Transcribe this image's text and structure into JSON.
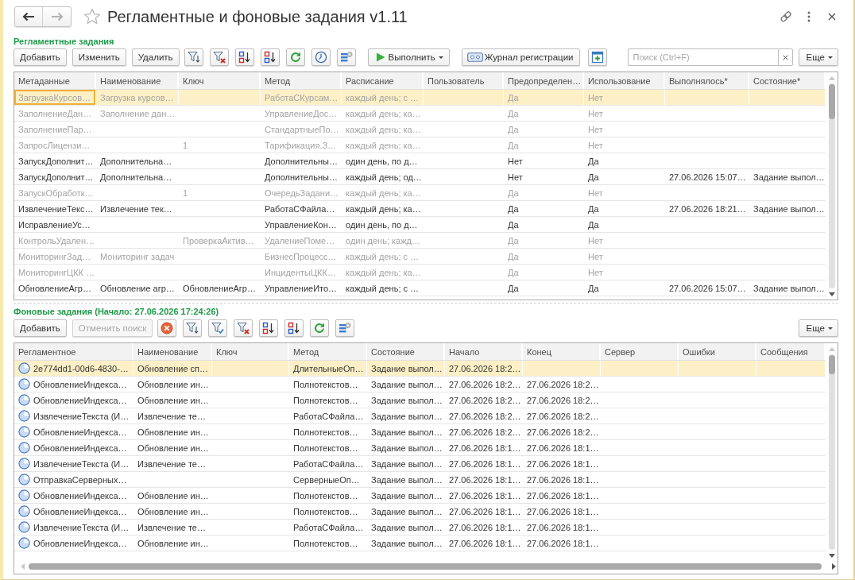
{
  "window": {
    "title": "Регламентные и фоновые задания v1.11",
    "favorite": false
  },
  "navigation": {
    "back": {
      "disabled": false
    },
    "forward": {
      "disabled": true
    }
  },
  "scheduled_jobs": {
    "title": "Регламентные задания",
    "toolbar": {
      "buttons": [
        {
          "label": "Добавить"
        },
        {
          "label": "Изменить"
        },
        {
          "label": "Удалить"
        }
      ],
      "run_button": {
        "label": "Выполнить"
      },
      "log_button": {
        "label": "Журнал регистрации"
      },
      "search": {
        "placeholder": "Поиск (Ctrl+F)"
      },
      "more_button": {
        "label": "Еще"
      }
    },
    "table": {
      "focused": true,
      "columns": [
        {
          "label": "Метаданные"
        },
        {
          "label": "Наименование"
        },
        {
          "label": "Ключ"
        },
        {
          "label": "Метод"
        },
        {
          "label": "Расписание"
        },
        {
          "label": "Пользователь"
        },
        {
          "label": "Предопределен…"
        },
        {
          "label": "Использование"
        },
        {
          "label": "Выполнялось*"
        },
        {
          "label": "Состояние*"
        }
      ],
      "rows": [
        {
          "selected": true,
          "inactive": true,
          "metadata": "ЗагрузкаКурсов…",
          "name": "Загрузка курсов…",
          "method": "РаботаСКурсам…",
          "schedule": "каждый день; с …",
          "predefined": "Да",
          "usage": "Нет"
        },
        {
          "selected": false,
          "inactive": true,
          "metadata": "ЗаполнениеДан…",
          "name": "Заполнение дан…",
          "method": "УправлениеДос…",
          "schedule": "каждый день; ка…",
          "predefined": "Да",
          "usage": "Нет"
        },
        {
          "selected": false,
          "inactive": true,
          "metadata": "ЗаполнениеПар…",
          "method": "СтандартныеПо…",
          "schedule": "каждый день; ка…",
          "predefined": "Да",
          "usage": "Нет"
        },
        {
          "selected": false,
          "inactive": true,
          "metadata": "ЗапросЛицензи…",
          "key": "1",
          "method": "Тарификация.З…",
          "schedule": "каждый день; ка…",
          "predefined": "Да",
          "usage": "Нет"
        },
        {
          "selected": false,
          "inactive": false,
          "metadata": "ЗапускДополнит…",
          "name": "Дополнительна…",
          "method": "Дополнительны…",
          "schedule": "один день, по д…",
          "predefined": "Нет",
          "usage": "Да"
        },
        {
          "selected": false,
          "inactive": false,
          "metadata": "ЗапускДополнит…",
          "name": "Дополнительна…",
          "method": "Дополнительны…",
          "schedule": "каждый день; од…",
          "predefined": "Нет",
          "usage": "Да",
          "last_run": "27.06.2026 15:07…",
          "state": "Задание выпол…"
        },
        {
          "selected": false,
          "inactive": true,
          "metadata": "ЗапускОбработк…",
          "key": "1",
          "method": "ОчередьЗадани…",
          "schedule": "каждый день; ка…",
          "predefined": "Да",
          "usage": "Нет"
        },
        {
          "selected": false,
          "inactive": false,
          "metadata": "ИзвлечениеТекс…",
          "name": "Извлечение тек…",
          "method": "РаботаСФайла…",
          "schedule": "каждый день; ка…",
          "predefined": "Да",
          "usage": "Да",
          "last_run": "27.06.2026 18:21…",
          "state": "Задание выпол…"
        },
        {
          "selected": false,
          "inactive": false,
          "metadata": "ИсправлениеУс…",
          "method": "УправлениеКон…",
          "schedule": "один день, по д…",
          "predefined": "Да",
          "usage": "Да"
        },
        {
          "selected": false,
          "inactive": true,
          "metadata": "КонтрольУдален…",
          "key": "ПроверкаАктив…",
          "method": "УдалениеПоме…",
          "schedule": "один день; кажд…",
          "predefined": "Да",
          "usage": "Нет"
        },
        {
          "selected": false,
          "inactive": true,
          "metadata": "МониторингЗад…",
          "name": "Мониторинг задач",
          "method": "БизнесПроцесс…",
          "schedule": "каждый день; с …",
          "predefined": "Да",
          "usage": "Нет"
        },
        {
          "selected": false,
          "inactive": true,
          "metadata": "МониторингЦКК …",
          "method": "ИнцидентыЦКК…",
          "schedule": "каждый день; ка…",
          "predefined": "Да",
          "usage": "Нет"
        },
        {
          "selected": false,
          "inactive": false,
          "metadata": "ОбновлениеАгр…",
          "name": "Обновление агр…",
          "key": "ОбновлениеАгр…",
          "method": "УправлениеИто…",
          "schedule": "каждый день; с …",
          "predefined": "Да",
          "usage": "Да",
          "last_run": "27.06.2026 15:07…",
          "state": "Задание выпол…"
        }
      ]
    }
  },
  "background_jobs": {
    "title": "Фоновые задания (Начало: 27.06.2026 17:24:26)",
    "toolbar": {
      "buttons": [
        {
          "label": "Добавить",
          "disabled": false
        },
        {
          "label": "Отменить поиск",
          "disabled": true
        }
      ],
      "more_button": {
        "label": "Еще"
      }
    },
    "table": {
      "focused": false,
      "columns": [
        {
          "label": "Регламентное"
        },
        {
          "label": "Наименование"
        },
        {
          "label": "Ключ"
        },
        {
          "label": "Метод"
        },
        {
          "label": "Состояние"
        },
        {
          "label": "Начало"
        },
        {
          "label": "Конец"
        },
        {
          "label": "Сервер"
        },
        {
          "label": "Ошибки"
        },
        {
          "label": "Сообщения"
        }
      ],
      "rows": [
        {
          "selected": true,
          "job": "2e774dd1-00d6-4830-…",
          "name": "Обновление сп…",
          "method": "ДлительныеОп…",
          "state": "Задание выпол…",
          "start": "27.06.2026 18:2…"
        },
        {
          "selected": false,
          "job": "ОбновлениеИндекса…",
          "name": "Обновление ин…",
          "method": "Полнотекстов…",
          "state": "Задание выпол…",
          "start": "27.06.2026 18:2…",
          "end": "27.06.2026 18:2…"
        },
        {
          "selected": false,
          "job": "ОбновлениеИндекса…",
          "name": "Обновление ин…",
          "method": "Полнотекстов…",
          "state": "Задание выпол…",
          "start": "27.06.2026 18:2…",
          "end": "27.06.2026 18:2…"
        },
        {
          "selected": false,
          "job": "ИзвлечениеТекста (И…",
          "name": "Извлечение те…",
          "method": "РаботаСФайла…",
          "state": "Задание выпол…",
          "start": "27.06.2026 18:2…",
          "end": "27.06.2026 18:2…"
        },
        {
          "selected": false,
          "job": "ОбновлениеИндекса…",
          "name": "Обновление ин…",
          "method": "Полнотекстов…",
          "state": "Задание выпол…",
          "start": "27.06.2026 18:2…",
          "end": "27.06.2026 18:2…"
        },
        {
          "selected": false,
          "job": "ОбновлениеИндекса…",
          "name": "Обновление ин…",
          "method": "Полнотекстов…",
          "state": "Задание выпол…",
          "start": "27.06.2026 18:1…",
          "end": "27.06.2026 18:1…"
        },
        {
          "selected": false,
          "job": "ИзвлечениеТекста (И…",
          "name": "Извлечение те…",
          "method": "РаботаСФайла…",
          "state": "Задание выпол…",
          "start": "27.06.2026 18:1…",
          "end": "27.06.2026 18:1…"
        },
        {
          "selected": false,
          "job": "ОтправкаСерверных…",
          "method": "СерверныеОп…",
          "state": "Задание выпол…",
          "start": "27.06.2026 18:1…",
          "end": "27.06.2026 18:1…"
        },
        {
          "selected": false,
          "job": "ОбновлениеИндекса…",
          "name": "Обновление ин…",
          "method": "Полнотекстов…",
          "state": "Задание выпол…",
          "start": "27.06.2026 18:1…",
          "end": "27.06.2026 18:1…"
        },
        {
          "selected": false,
          "job": "ОбновлениеИндекса…",
          "name": "Обновление ин…",
          "method": "Полнотекстов…",
          "state": "Задание выпол…",
          "start": "27.06.2026 18:1…",
          "end": "27.06.2026 18:1…"
        },
        {
          "selected": false,
          "job": "ИзвлечениеТекста (И…",
          "name": "Извлечение те…",
          "method": "РаботаСФайла…",
          "state": "Задание выпол…",
          "start": "27.06.2026 18:1…",
          "end": "27.06.2026 18:1…"
        },
        {
          "selected": false,
          "job": "ОбновлениеИндекса…",
          "name": "Обновление ин…",
          "method": "Полнотекстов…",
          "state": "Задание выпол…",
          "start": "27.06.2026 18:1…",
          "end": "27.06.2026 18:1…"
        }
      ]
    }
  }
}
